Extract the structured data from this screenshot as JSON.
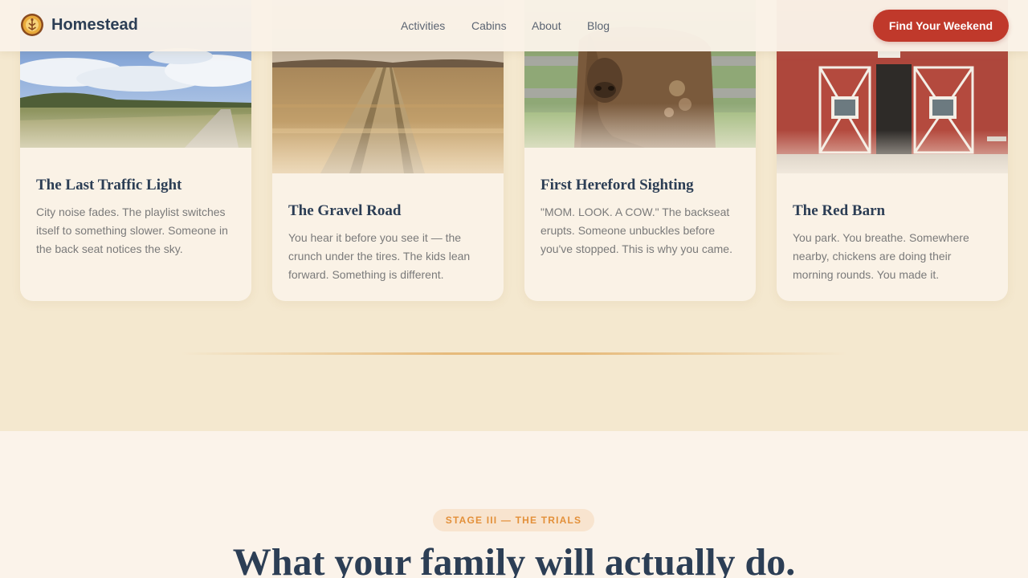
{
  "nav": {
    "brand": "Homestead",
    "links": [
      "Activities",
      "Cabins",
      "About",
      "Blog"
    ],
    "cta": "Find Your Weekend"
  },
  "cards": [
    {
      "title": "The Last Traffic Light",
      "text": "City noise fades. The playlist switches itself to something slower. Someone in the back seat notices the sky."
    },
    {
      "title": "The Gravel Road",
      "text": "You hear it before you see it — the crunch under the tires. The kids lean forward. Something is different."
    },
    {
      "title": "First Hereford Sighting",
      "text": "\"MOM. LOOK. A COW.\" The backseat erupts. Someone unbuckles before you've stopped. This is why you came."
    },
    {
      "title": "The Red Barn",
      "text": "You park. You breathe. Somewhere nearby, chickens are doing their morning rounds. You made it."
    }
  ],
  "section": {
    "badge": "STAGE III — THE TRIALS",
    "heading": "What your family will actually do."
  },
  "colors": {
    "accent": "#c0392b",
    "navy": "#2c3e55",
    "badge_text": "#e3903a",
    "page_bg": "#f4e8cf"
  }
}
